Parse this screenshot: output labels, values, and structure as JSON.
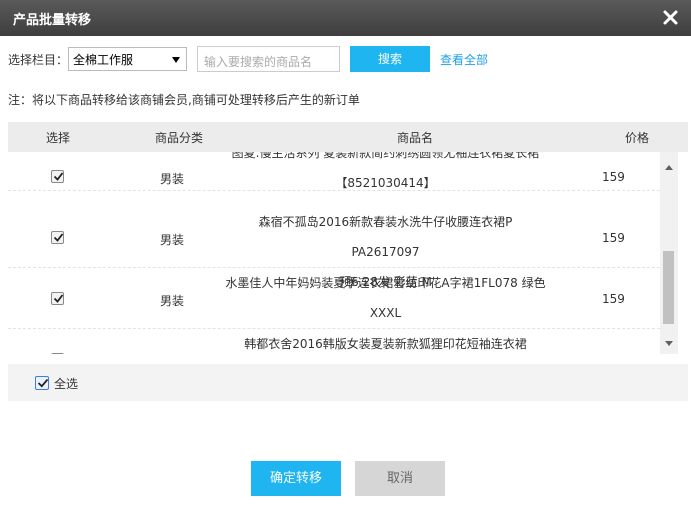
{
  "dialog": {
    "title": "产品批量转移",
    "close_icon": "close-icon"
  },
  "filter": {
    "label": "选择栏目：",
    "selected_category": "全棉工作服",
    "search_placeholder": "输入要搜索的商品名",
    "search_button": "搜索",
    "view_all": "查看全部"
  },
  "note": "注：将以下商品转移给该商铺会员,商铺可处理转移后产生的新订单",
  "table": {
    "headers": {
      "select": "选择",
      "category": "商品分类",
      "name": "商品名",
      "price": "价格"
    },
    "rows": [
      {
        "checked": true,
        "category": "男装",
        "name_line1": "图夏.慢生活系列 夏装新款简约刺绣圆领无袖连衣裙夏长裙",
        "name_line2": "【8521030414】",
        "price": "159"
      },
      {
        "checked": true,
        "category": "男装",
        "name_line1": "森宿不孤岛2016新款春装水洗牛仔收腰连衣裙P PA2617097",
        "name_line2": "预6.28发 彩蓝 M",
        "price": "159"
      },
      {
        "checked": true,
        "category": "男装",
        "name_line1": "水墨佳人中年妈妈装夏季连衣裙雪纺印花A字裙1FL078 绿色",
        "name_line2": "XXXL",
        "price": "159"
      },
      {
        "checked": true,
        "category": "男装",
        "name_line1": "韩都衣舍2016韩版女装夏装新款狐狸印花短袖连衣裙",
        "name_line2": "",
        "price": "159"
      }
    ]
  },
  "select_all": {
    "label": "全选",
    "checked": true
  },
  "buttons": {
    "confirm": "确定转移",
    "cancel": "取消"
  },
  "colors": {
    "accent": "#1eb5f0",
    "titlebar": "#4a4a4a",
    "link": "#1e9fe8"
  }
}
